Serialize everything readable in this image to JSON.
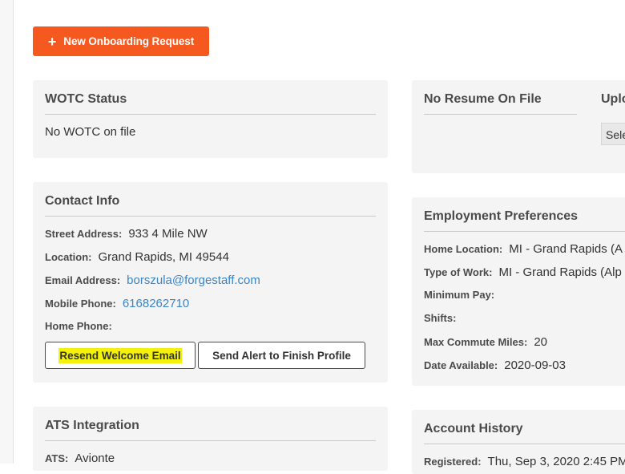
{
  "new_request_button": {
    "icon": "plus-icon",
    "label": "New Onboarding Request"
  },
  "wotc": {
    "title": "WOTC Status",
    "text": "No WOTC on file"
  },
  "resume": {
    "title": "No Resume On File",
    "upload_title_partial": "Uplo",
    "select_partial": "Sele"
  },
  "contact": {
    "title": "Contact Info",
    "street_label": "Street Address:",
    "street_value": "933 4 Mile NW",
    "location_label": "Location:",
    "location_value": "Grand Rapids, MI 49544",
    "email_label": "Email Address:",
    "email_value": "borszula@forgestaff.com",
    "mobile_label": "Mobile Phone:",
    "mobile_value": "6168262710",
    "home_label": "Home Phone:",
    "home_value": "",
    "resend_button": "Resend Welcome Email",
    "alert_button": "Send Alert to Finish Profile"
  },
  "employment": {
    "title": "Employment Preferences",
    "home_location_label": "Home Location:",
    "home_location_value": "MI - Grand Rapids (A",
    "type_of_work_label": "Type of Work:",
    "type_of_work_value": "MI - Grand Rapids (Alp",
    "min_pay_label": "Minimum Pay:",
    "min_pay_value": "",
    "shifts_label": "Shifts:",
    "shifts_value": "",
    "max_commute_label": "Max Commute Miles:",
    "max_commute_value": "20",
    "date_available_label": "Date Available:",
    "date_available_value": "2020-09-03"
  },
  "ats": {
    "title": "ATS Integration",
    "ats_label": "ATS:",
    "ats_value": "Avionte"
  },
  "account_history": {
    "title": "Account History",
    "registered_label": "Registered:",
    "registered_value": "Thu, Sep 3, 2020 2:45 PM"
  },
  "colors": {
    "accent": "#f5591f",
    "link": "#3b84c5",
    "highlight": "#f4f20a",
    "card_bg": "#f4f4f4"
  }
}
